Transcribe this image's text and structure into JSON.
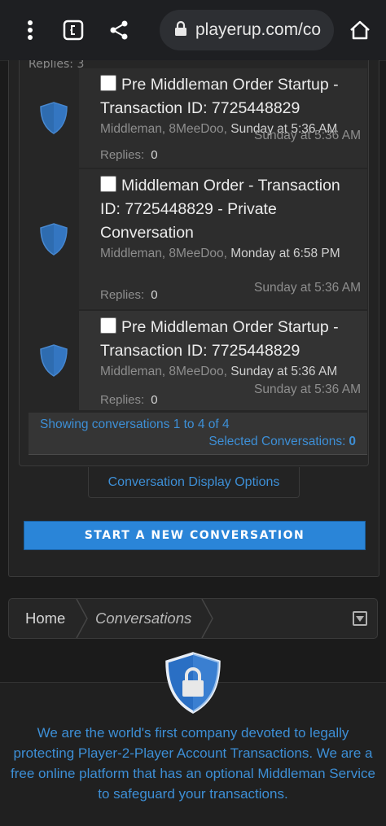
{
  "browser": {
    "url": "playerup.com/co",
    "icons": [
      "more-vert-icon",
      "tab-switcher-icon",
      "share-icon",
      "lock-icon",
      "home-icon"
    ]
  },
  "partial_row": {
    "text": "Replies:   3"
  },
  "conversations": [
    {
      "title": "Pre Middleman Order Startup - Transaction ID: 7725448829",
      "meta_participants": "Middleman, 8MeeDoo,",
      "meta_start": "Sunday at 5:36 AM",
      "last_message": "Sunday at 5:36 AM",
      "replies_label": "Replies:",
      "replies_count": "0"
    },
    {
      "title": "Middleman Order - Transaction ID: 7725448829 - Private Conversation",
      "meta_participants": "Middleman, 8MeeDoo,",
      "meta_start": "Monday at 6:58 PM",
      "last_message": "Sunday at 5:36 AM",
      "replies_label": "Replies:",
      "replies_count": "0"
    },
    {
      "title": "Pre Middleman Order Startup - Transaction ID: 7725448829",
      "meta_participants": "Middleman, 8MeeDoo,",
      "meta_start": "Sunday at 5:36 AM",
      "last_message": "Sunday at 5:36 AM",
      "replies_label": "Replies:",
      "replies_count": "0"
    }
  ],
  "list_footer": {
    "showing": "Showing conversations 1 to 4 of 4",
    "selected_label": "Selected Conversations:",
    "selected_count": "0"
  },
  "display_options_label": "Conversation Display Options",
  "new_conversation_label": "START A NEW CONVERSATION",
  "breadcrumb": {
    "home": "Home",
    "current": "Conversations"
  },
  "footer": {
    "text": "We are the world's first company devoted to legally protecting Player-2-Player Account Transactions. We are a free online platform that has an optional Middleman Service to safeguard your transactions."
  },
  "colors": {
    "link": "#3d8fd6",
    "button": "#2a85d8",
    "background": "#1b1b1b",
    "shield": "#3a7fd0"
  }
}
